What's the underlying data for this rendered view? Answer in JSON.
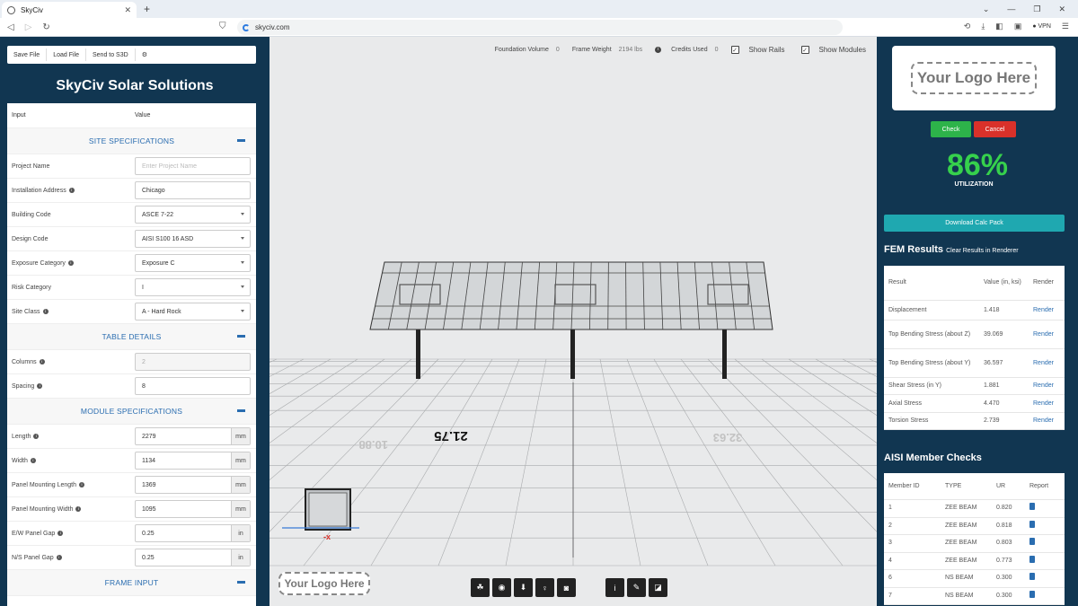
{
  "browser": {
    "tab_title": "SkyCiv",
    "url": "skyciv.com",
    "vpn_label": "VPN"
  },
  "toolbar": {
    "save_file": "Save File",
    "load_file": "Load File",
    "send_s3d": "Send to S3D"
  },
  "app_title": "SkyCiv Solar Solutions",
  "form": {
    "col_input": "Input",
    "col_value": "Value",
    "sections": {
      "site": "SITE SPECIFICATIONS",
      "table": "TABLE DETAILS",
      "module": "MODULE SPECIFICATIONS",
      "frame": "FRAME INPUT"
    },
    "site_rows": [
      {
        "label": "Project Name",
        "value": "Enter Project Name",
        "info": false
      },
      {
        "label": "Installation Address",
        "value": "Chicago",
        "info": true
      },
      {
        "label": "Building Code",
        "value": "ASCE 7-22",
        "info": false
      },
      {
        "label": "Design Code",
        "value": "AISI S100 16 ASD",
        "info": false
      },
      {
        "label": "Exposure Category",
        "value": "Exposure C",
        "info": true
      },
      {
        "label": "Risk Category",
        "value": "I",
        "info": false
      },
      {
        "label": "Site Class",
        "value": "A - Hard Rock",
        "info": true
      }
    ],
    "table_rows": [
      {
        "label": "Columns",
        "value": "2",
        "info": true
      },
      {
        "label": "Spacing",
        "value": "8",
        "info": true
      }
    ],
    "module_rows": [
      {
        "label": "Length",
        "value": "2279",
        "unit": "mm",
        "info": true
      },
      {
        "label": "Width",
        "value": "1134",
        "unit": "mm",
        "info": true
      },
      {
        "label": "Panel Mounting Length",
        "value": "1369",
        "unit": "mm",
        "info": true
      },
      {
        "label": "Panel Mounting Width",
        "value": "1095",
        "unit": "mm",
        "info": true
      },
      {
        "label": "E/W Panel Gap",
        "value": "0.25",
        "unit": "in",
        "info": true
      },
      {
        "label": "N/S Panel Gap",
        "value": "0.25",
        "unit": "in",
        "info": true
      }
    ]
  },
  "viewport": {
    "foundation_volume_label": "Foundation Volume",
    "foundation_volume": "0",
    "frame_weight_label": "Frame Weight",
    "frame_weight": "2194 lbs",
    "credits_used_label": "Credits Used",
    "credits_used": "0",
    "show_rails": "Show Rails",
    "show_modules": "Show Modules",
    "dim_left": "10.88",
    "dim_center": "21.75",
    "dim_right": "32.63",
    "logo_text": "Your Logo Here"
  },
  "right": {
    "logo_text": "Your Logo Here",
    "check": "Check",
    "cancel": "Cancel",
    "utilization": "86%",
    "utilization_label": "UTILIZATION",
    "download": "Download Calc Pack",
    "fem_title": "FEM Results",
    "fem_clear": "Clear Results in Renderer",
    "fem_headers": [
      "Result",
      "Value (in, ksi)",
      "Render"
    ],
    "fem_rows": [
      [
        "Displacement",
        "1.418",
        "Render"
      ],
      [
        "Top Bending Stress (about Z)",
        "39.069",
        "Render"
      ],
      [
        "Top Bending Stress (about Y)",
        "36.597",
        "Render"
      ],
      [
        "Shear Stress (in Y)",
        "1.881",
        "Render"
      ],
      [
        "Axial Stress",
        "4.470",
        "Render"
      ],
      [
        "Torsion Stress",
        "2.739",
        "Render"
      ]
    ],
    "aisi_title": "AISI Member Checks",
    "aisi_headers": [
      "Member ID",
      "TYPE",
      "UR",
      "Report"
    ],
    "aisi_rows": [
      [
        "1",
        "ZEE BEAM",
        "0.820"
      ],
      [
        "2",
        "ZEE BEAM",
        "0.818"
      ],
      [
        "3",
        "ZEE BEAM",
        "0.803"
      ],
      [
        "4",
        "ZEE BEAM",
        "0.773"
      ],
      [
        "6",
        "NS BEAM",
        "0.300"
      ],
      [
        "7",
        "NS BEAM",
        "0.300"
      ]
    ]
  },
  "colors": {
    "navy": "#113651",
    "link": "#2a6db0",
    "green": "#36d14c",
    "check": "#2db34a",
    "cancel": "#d9312a",
    "teal": "#1fa8b0"
  }
}
